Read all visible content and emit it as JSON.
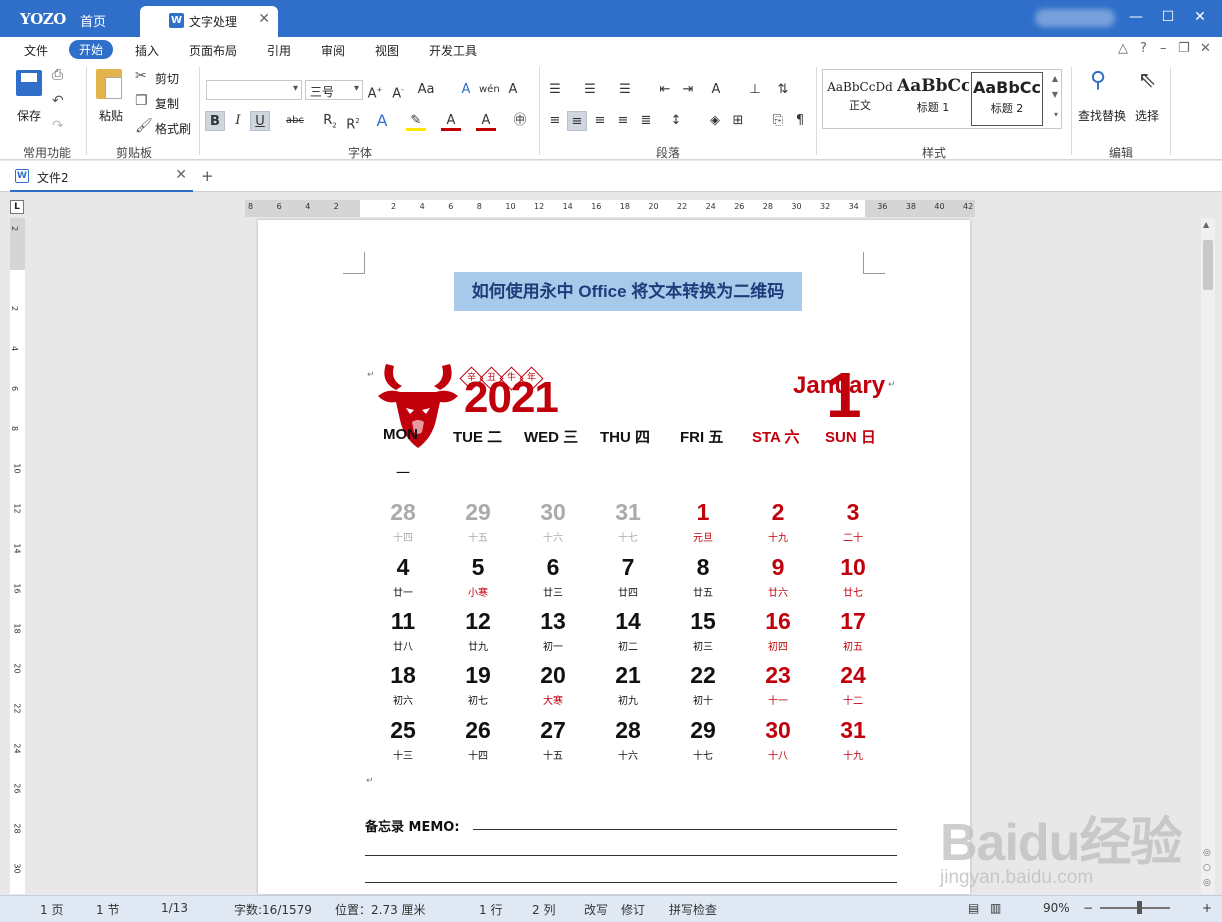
{
  "titlebar": {
    "logo": "YOZO",
    "home_tab": "首页",
    "doc_tab": "文字处理",
    "doc_tab_icon": "W"
  },
  "menu": {
    "items": [
      "文件",
      "开始",
      "插入",
      "页面布局",
      "引用",
      "审阅",
      "视图",
      "开发工具"
    ],
    "active": "开始"
  },
  "ribbon": {
    "common": {
      "save": "保存",
      "group": "常用功能"
    },
    "clipboard": {
      "paste": "粘贴",
      "cut": "剪切",
      "copy": "复制",
      "format_painter": "格式刷",
      "group": "剪贴板"
    },
    "font": {
      "font_name": "",
      "font_size": "三号",
      "group": "字体"
    },
    "paragraph": {
      "group": "段落"
    },
    "styles": {
      "items": [
        {
          "sample": "AaBbCcDd",
          "name": "正文"
        },
        {
          "sample": "AaBbCc",
          "name": "标题 1"
        },
        {
          "sample": "AaBbCc",
          "name": "标题 2"
        }
      ],
      "group": "样式"
    },
    "editing": {
      "find_replace": "查找替换",
      "select": "选择",
      "group": "编辑"
    }
  },
  "doctab": {
    "label": "文件2",
    "add": "+"
  },
  "ruler": {
    "h_labels": [
      "8",
      "6",
      "4",
      "2",
      "",
      "2",
      "4",
      "6",
      "8",
      "10",
      "12",
      "14",
      "16",
      "18",
      "20",
      "22",
      "24",
      "26",
      "28",
      "30",
      "32",
      "34",
      "36",
      "38",
      "40",
      "42"
    ],
    "v_labels": [
      "2",
      "",
      "2",
      "4",
      "6",
      "8",
      "10",
      "12",
      "14",
      "16",
      "18",
      "20",
      "22",
      "24",
      "26",
      "28",
      "30"
    ],
    "corner": "L"
  },
  "document": {
    "title": "如何使用永中 Office 将文本转换为二维码",
    "calendar": {
      "year": "2021",
      "zodiac": [
        "辛",
        "丑",
        "牛",
        "年"
      ],
      "month_number": "1",
      "month_name": "January",
      "weekdays": [
        "MON",
        "TUE 二",
        "WED 三",
        "THU 四",
        "FRI 五",
        "STA 六",
        "SUN 日"
      ],
      "mon_tail": "一",
      "weeks": [
        [
          {
            "d": "28",
            "l": "十四",
            "t": "grey"
          },
          {
            "d": "29",
            "l": "十五",
            "t": "grey"
          },
          {
            "d": "30",
            "l": "十六",
            "t": "grey"
          },
          {
            "d": "31",
            "l": "十七",
            "t": "grey"
          },
          {
            "d": "1",
            "l": "元旦",
            "t": "red",
            "lt": "red"
          },
          {
            "d": "2",
            "l": "十九",
            "t": "red"
          },
          {
            "d": "3",
            "l": "二十",
            "t": "red"
          }
        ],
        [
          {
            "d": "4",
            "l": "廿一"
          },
          {
            "d": "5",
            "l": "小寒",
            "lt": "red"
          },
          {
            "d": "6",
            "l": "廿三"
          },
          {
            "d": "7",
            "l": "廿四"
          },
          {
            "d": "8",
            "l": "廿五"
          },
          {
            "d": "9",
            "l": "廿六",
            "t": "red"
          },
          {
            "d": "10",
            "l": "廿七",
            "t": "red"
          }
        ],
        [
          {
            "d": "11",
            "l": "廿八"
          },
          {
            "d": "12",
            "l": "廿九"
          },
          {
            "d": "13",
            "l": "初一"
          },
          {
            "d": "14",
            "l": "初二"
          },
          {
            "d": "15",
            "l": "初三"
          },
          {
            "d": "16",
            "l": "初四",
            "t": "red"
          },
          {
            "d": "17",
            "l": "初五",
            "t": "red"
          }
        ],
        [
          {
            "d": "18",
            "l": "初六"
          },
          {
            "d": "19",
            "l": "初七"
          },
          {
            "d": "20",
            "l": "大寒",
            "lt": "red"
          },
          {
            "d": "21",
            "l": "初九"
          },
          {
            "d": "22",
            "l": "初十"
          },
          {
            "d": "23",
            "l": "十一",
            "t": "red"
          },
          {
            "d": "24",
            "l": "十二",
            "t": "red"
          }
        ],
        [
          {
            "d": "25",
            "l": "十三"
          },
          {
            "d": "26",
            "l": "十四"
          },
          {
            "d": "27",
            "l": "十五"
          },
          {
            "d": "28",
            "l": "十六"
          },
          {
            "d": "29",
            "l": "十七"
          },
          {
            "d": "30",
            "l": "十八",
            "t": "red"
          },
          {
            "d": "31",
            "l": "十九",
            "t": "red"
          }
        ]
      ]
    },
    "memo": "备忘录 MEMO:"
  },
  "statusbar": {
    "page": "1 页",
    "section": "1 节",
    "pages": "1/13",
    "word_count": "字数:16/1579",
    "position": "位置：2.73 厘米",
    "line": "1 行",
    "column": "2 列",
    "overwrite": "改写",
    "revise": "修订",
    "spell_check": "拼写检查",
    "zoom": "90%"
  },
  "watermark": {
    "brand": "Baidu经验",
    "url": "jingyan.baidu.com"
  },
  "colors": {
    "accent": "#2f6fc9",
    "calendar_red": "#c0000b",
    "title_highlight": "#a7caeb"
  }
}
